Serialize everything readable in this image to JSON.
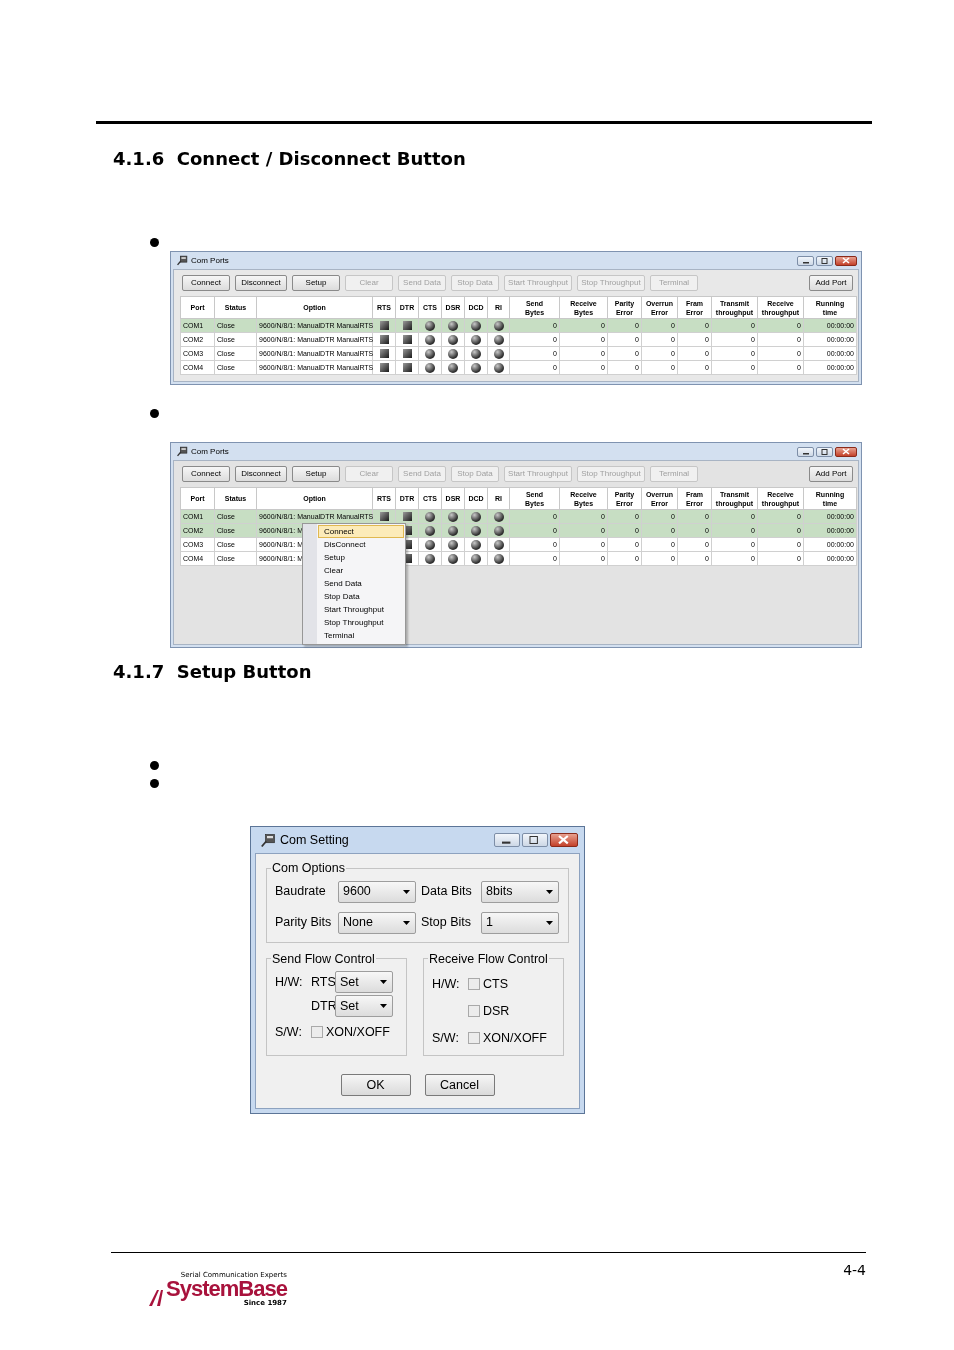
{
  "sections": [
    {
      "heading": "4.1.6  Connect / Disconnect Button",
      "blocks": [
        {
          "kind": "bullet"
        },
        {
          "kind": "com_ports",
          "title": "Com Ports",
          "toolbar": [
            {
              "label": "Connect",
              "disabled": false
            },
            {
              "label": "Disconnect",
              "disabled": false
            },
            {
              "label": "Setup",
              "disabled": false
            },
            {
              "label": "Clear",
              "disabled": true
            },
            {
              "label": "Send Data",
              "disabled": true
            },
            {
              "label": "Stop Data",
              "disabled": true
            },
            {
              "label": "Start Throughput",
              "disabled": true
            },
            {
              "label": "Stop Throughput",
              "disabled": true
            },
            {
              "label": "Terminal",
              "disabled": true
            }
          ],
          "add_port": "Add Port",
          "columns": [
            "Port",
            "Status",
            "Option",
            "RTS",
            "DTR",
            "CTS",
            "DSR",
            "DCD",
            "RI",
            "Send\nBytes",
            "Receive\nBytes",
            "Parity\nError",
            "Overrun\nError",
            "Fram\nError",
            "Transmit\nthroughput",
            "Receive\nthroughput",
            "Running\ntime"
          ],
          "rows": [
            {
              "selected": true,
              "cells": [
                "COM1",
                "Close",
                "9600/N/8/1: ManualDTR ManualRTS",
                "",
                "",
                "",
                "",
                "",
                "",
                "0",
                "0",
                "0",
                "0",
                "0",
                "0",
                "0",
                "00:00:00"
              ]
            },
            {
              "selected": false,
              "cells": [
                "COM2",
                "Close",
                "9600/N/8/1: ManualDTR ManualRTS",
                "",
                "",
                "",
                "",
                "",
                "",
                "0",
                "0",
                "0",
                "0",
                "0",
                "0",
                "0",
                "00:00:00"
              ]
            },
            {
              "selected": false,
              "cells": [
                "COM3",
                "Close",
                "9600/N/8/1: ManualDTR ManualRTS",
                "",
                "",
                "",
                "",
                "",
                "",
                "0",
                "0",
                "0",
                "0",
                "0",
                "0",
                "0",
                "00:00:00"
              ]
            },
            {
              "selected": false,
              "cells": [
                "COM4",
                "Close",
                "9600/N/8/1: ManualDTR ManualRTS",
                "",
                "",
                "",
                "",
                "",
                "",
                "0",
                "0",
                "0",
                "0",
                "0",
                "0",
                "0",
                "00:00:00"
              ]
            }
          ]
        },
        {
          "kind": "bullet"
        },
        {
          "kind": "com_ports",
          "title": "Com Ports",
          "toolbar": [
            {
              "label": "Connect",
              "disabled": false
            },
            {
              "label": "Disconnect",
              "disabled": false
            },
            {
              "label": "Setup",
              "disabled": false
            },
            {
              "label": "Clear",
              "disabled": true
            },
            {
              "label": "Send Data",
              "disabled": true
            },
            {
              "label": "Stop Data",
              "disabled": true
            },
            {
              "label": "Start Throughput",
              "disabled": true
            },
            {
              "label": "Stop Throughput",
              "disabled": true
            },
            {
              "label": "Terminal",
              "disabled": true
            }
          ],
          "add_port": "Add Port",
          "columns": [
            "Port",
            "Status",
            "Option",
            "RTS",
            "DTR",
            "CTS",
            "DSR",
            "DCD",
            "RI",
            "Send\nBytes",
            "Receive\nBytes",
            "Parity\nError",
            "Overrun\nError",
            "Fram\nError",
            "Transmit\nthroughput",
            "Receive\nthroughput",
            "Running\ntime"
          ],
          "rows": [
            {
              "selected": true,
              "cells": [
                "COM1",
                "Close",
                "9600/N/8/1: ManualDTR ManualRTS",
                "",
                "",
                "",
                "",
                "",
                "",
                "0",
                "0",
                "0",
                "0",
                "0",
                "0",
                "0",
                "00:00:00"
              ]
            },
            {
              "selected": true,
              "cells": [
                "COM2",
                "Close",
                "9600/N/8/1: M",
                "",
                "",
                "",
                "",
                "",
                "",
                "0",
                "0",
                "0",
                "0",
                "0",
                "0",
                "0",
                "00:00:00"
              ],
              "context_menu": [
                {
                  "label": "Connect",
                  "selected": true
                },
                {
                  "label": "DisConnect",
                  "selected": false
                },
                {
                  "label": "Setup",
                  "selected": false
                },
                {
                  "label": "Clear",
                  "selected": false
                },
                {
                  "label": "Send Data",
                  "selected": false
                },
                {
                  "label": "Stop Data",
                  "selected": false
                },
                {
                  "label": "Start Throughput",
                  "selected": false
                },
                {
                  "label": "Stop Throughput",
                  "selected": false
                },
                {
                  "label": "Terminal",
                  "selected": false
                }
              ]
            },
            {
              "selected": false,
              "cells": [
                "COM3",
                "Close",
                "9600/N/8/1: M",
                "",
                "",
                "",
                "",
                "",
                "",
                "0",
                "0",
                "0",
                "0",
                "0",
                "0",
                "0",
                "00:00:00"
              ]
            },
            {
              "selected": false,
              "cells": [
                "COM4",
                "Close",
                "9600/N/8/1: M",
                "",
                "",
                "",
                "",
                "",
                "",
                "0",
                "0",
                "0",
                "0",
                "0",
                "0",
                "0",
                "00:00:00"
              ]
            }
          ]
        }
      ]
    },
    {
      "heading": "4.1.7  Setup Button",
      "blocks": [
        {
          "kind": "bullet"
        },
        {
          "kind": "bullet"
        },
        {
          "kind": "com_setting",
          "title": "Com Setting",
          "com_options": {
            "label": "Com Options",
            "fields": [
              {
                "label": "Baudrate",
                "value": "9600"
              },
              {
                "label": "Data Bits",
                "value": "8bits"
              },
              {
                "label": "Parity Bits",
                "value": "None"
              },
              {
                "label": "Stop Bits",
                "value": "1"
              }
            ]
          },
          "send_flow": {
            "label": "Send Flow Control",
            "hw_label": "H/W:",
            "rts": {
              "label": "RTS",
              "value": "Set"
            },
            "dtr": {
              "label": "DTR",
              "value": "Set"
            },
            "sw_label": "S/W:",
            "xon_xoff": {
              "label": "XON/XOFF",
              "checked": false
            }
          },
          "receive_flow": {
            "label": "Receive Flow Control",
            "hw_label": "H/W:",
            "cts": {
              "label": "CTS",
              "checked": false
            },
            "dsr": {
              "label": "DSR",
              "checked": false
            },
            "sw_label": "S/W:",
            "xon_xoff": {
              "label": "XON/XOFF",
              "checked": false
            }
          },
          "buttons": [
            "OK",
            "Cancel"
          ]
        }
      ]
    }
  ],
  "footer": {
    "page_number": "4-4",
    "logo": {
      "tagline": "Serial Communication Experts",
      "name": "SystemBase",
      "since": "Since 1987"
    }
  }
}
